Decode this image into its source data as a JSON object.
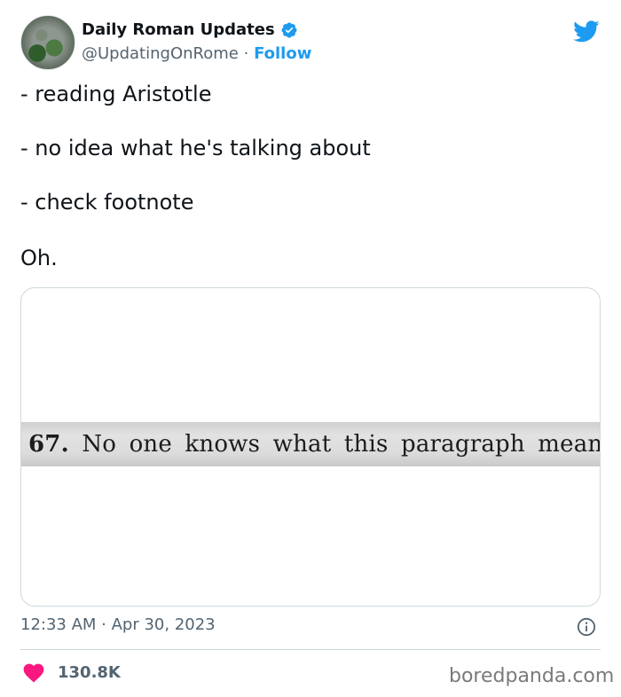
{
  "author": {
    "display_name": "Daily Roman Updates",
    "handle": "@UpdatingOnRome",
    "separator": "·",
    "follow_label": "Follow",
    "verified_icon": "verified-badge-icon",
    "brand_icon": "twitter-bird-icon"
  },
  "tweet": {
    "lines": [
      "- reading Aristotle",
      "- no idea what he's talking about",
      "- check footnote",
      "Oh."
    ]
  },
  "media": {
    "footnote_number": "67.",
    "footnote_text": "No one knows what this paragraph means."
  },
  "meta": {
    "timestamp": "12:33 AM · Apr 30, 2023",
    "info_icon": "info-icon",
    "like_count": "130.8K",
    "like_icon": "heart-icon"
  },
  "watermark": "boredpanda.com",
  "colors": {
    "accent": "#1d9bf0",
    "text": "#0f1419",
    "secondary": "#536471",
    "heart": "#f91880",
    "border": "#cfd9de"
  }
}
